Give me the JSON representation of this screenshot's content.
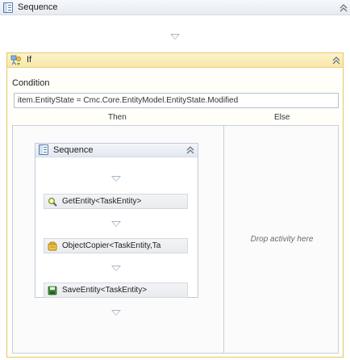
{
  "outer_sequence": {
    "title": "Sequence",
    "icon": "sequence-icon",
    "collapse_icon": "double-chevron-up-icon"
  },
  "if_activity": {
    "title": "If",
    "icon": "if-activity-icon",
    "collapse_icon": "double-chevron-up-icon",
    "condition_label": "Condition",
    "condition_value": "item.EntityState = Cmc.Core.EntityModel.EntityState.Modified",
    "then_label": "Then",
    "else_label": "Else",
    "else_placeholder": "Drop activity here"
  },
  "inner_sequence": {
    "title": "Sequence",
    "icon": "sequence-icon",
    "collapse_icon": "double-chevron-up-icon",
    "activities": [
      {
        "label": "GetEntity<TaskEntity>",
        "icon": "magnifier-icon",
        "color": "#7a9a2e"
      },
      {
        "label": "ObjectCopier<TaskEntity,Ta",
        "icon": "object-copier-icon",
        "color": "#d9a321"
      },
      {
        "label": "SaveEntity<TaskEntity>",
        "icon": "save-icon",
        "color": "#3f8f3a"
      }
    ]
  },
  "colors": {
    "if_accent": "#f8e7a8",
    "if_border": "#e8c664",
    "sequence_header": "#e7ebf1",
    "drop_arrow": "#a9b6c6"
  }
}
